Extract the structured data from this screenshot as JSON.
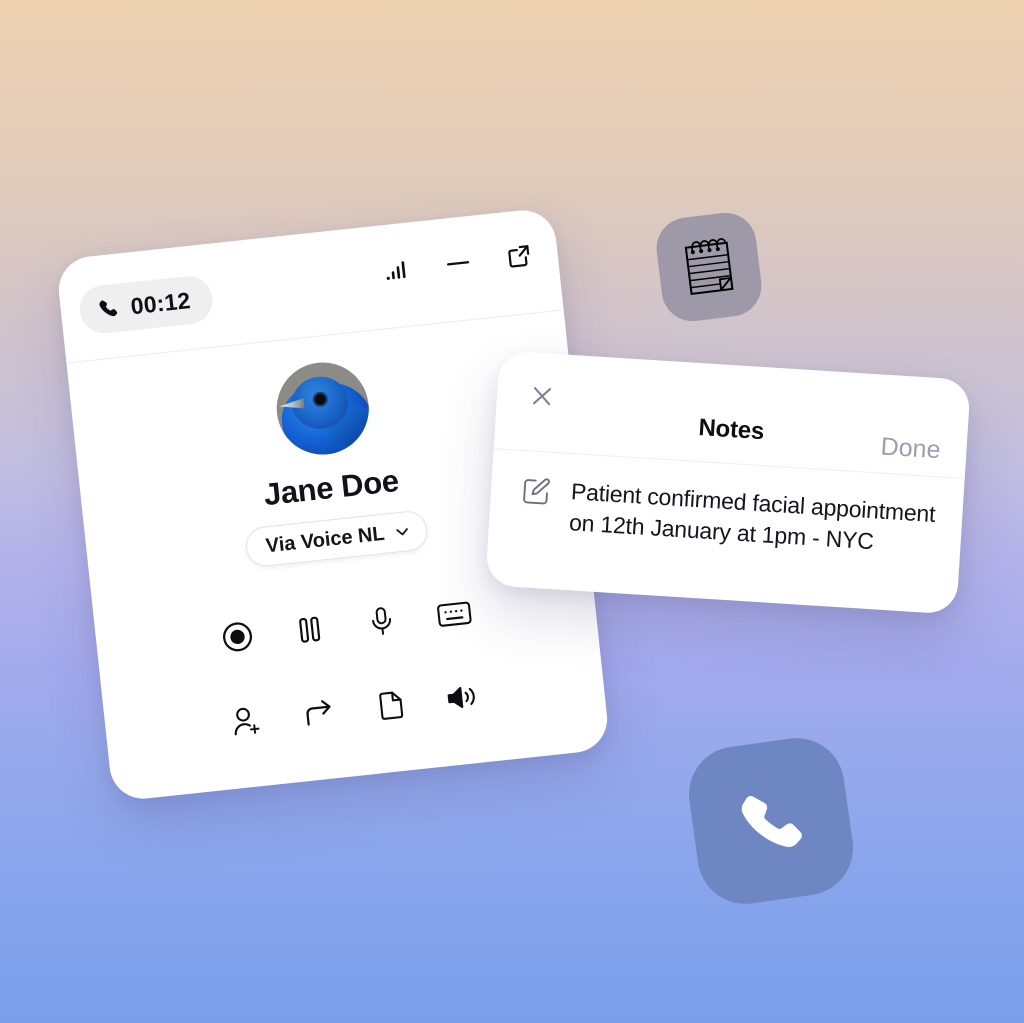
{
  "background": {
    "gradient_top": "#eed3b2",
    "gradient_mid": "#b3b2ea",
    "gradient_bottom": "#7b9fea"
  },
  "app_tiles": {
    "notes": {
      "icon": "notepad-icon",
      "glyph": "🗒",
      "color": "#9e99a8"
    },
    "phone": {
      "icon": "phone-icon",
      "color": "#6e87c2"
    }
  },
  "call_window": {
    "timer": {
      "icon": "phone-icon",
      "value": "00:12"
    },
    "header_actions": [
      {
        "name": "signal-strength-icon",
        "label": "Signal"
      },
      {
        "name": "minimize-button",
        "label": "Minimize"
      },
      {
        "name": "expand-button",
        "label": "Open in new window"
      }
    ],
    "contact": {
      "name": "Jane Doe",
      "avatar_alt": "Blue bird profile photo"
    },
    "route_selector": {
      "label": "Via Voice NL",
      "chevron": "chevron-down-icon"
    },
    "controls": [
      {
        "name": "record-button",
        "label": "Record"
      },
      {
        "name": "pause-button",
        "label": "Pause"
      },
      {
        "name": "mute-button",
        "label": "Microphone"
      },
      {
        "name": "keypad-button",
        "label": "Keypad"
      },
      {
        "name": "add-person-button",
        "label": "Add person"
      },
      {
        "name": "transfer-button",
        "label": "Transfer"
      },
      {
        "name": "notes-button",
        "label": "Notes"
      },
      {
        "name": "speaker-button",
        "label": "Speaker"
      }
    ]
  },
  "notes_window": {
    "close_label": "Close",
    "title": "Notes",
    "done_label": "Done",
    "note_icon": "edit-square-icon",
    "note_text": "Patient confirmed facial appointment on 12th January at 1pm - NYC"
  }
}
